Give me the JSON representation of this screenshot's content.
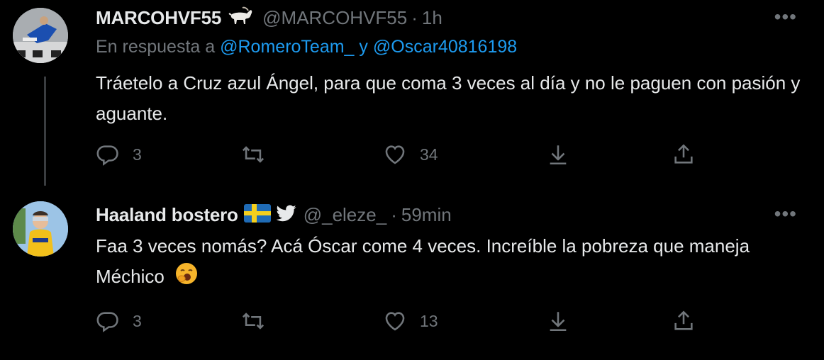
{
  "tweets": [
    {
      "name": "MARCOHVF55",
      "name_emoji": "goat-emoji",
      "handle": "@MARCOHVF55",
      "separator": "·",
      "time": "1h",
      "reply_to": {
        "prefix": "En respuesta a",
        "mention1": "@RomeroTeam_",
        "conjunction": "y",
        "mention2": "@Oscar40816198"
      },
      "text": "Tráetelo a Cruz azul Ángel, para que coma 3 veces al día y no le paguen con pasión y aguante.",
      "replies": "3",
      "retweets": "",
      "likes": "34"
    },
    {
      "name": "Haaland bostero",
      "name_emoji": "sweden-flag-emoji twitter-bird-icon",
      "handle": "@_eleze_",
      "separator": "·",
      "time": "59min",
      "text": "Faa 3 veces nomás? Acá Óscar come 4 veces. Increíble la pobreza que maneja Méchico",
      "text_emoji": "yawning-face-emoji",
      "replies": "3",
      "retweets": "",
      "likes": "13"
    }
  ],
  "colors": {
    "background": "#000000",
    "text": "#e7e9ea",
    "secondary": "#71767b",
    "link": "#1d9bf0",
    "thread_line": "#3a3d40"
  }
}
